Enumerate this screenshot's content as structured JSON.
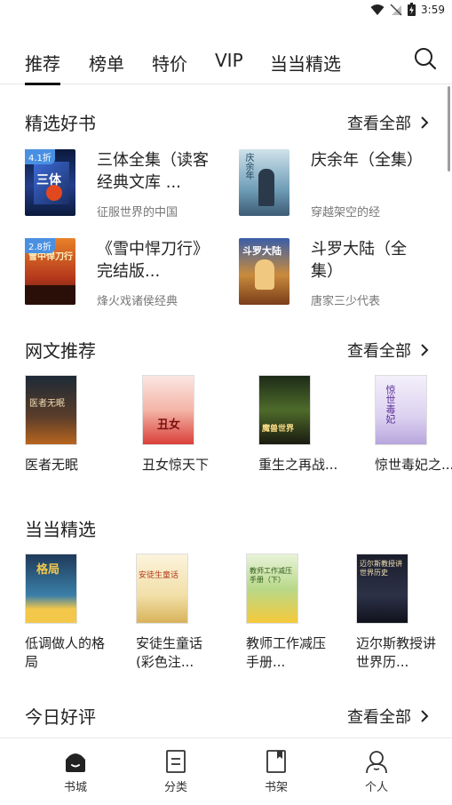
{
  "status": {
    "time": "3:59"
  },
  "tabs": [
    {
      "label": "推荐",
      "active": true
    },
    {
      "label": "榜单"
    },
    {
      "label": "特价"
    },
    {
      "label": "VIP"
    },
    {
      "label": "当当精选"
    }
  ],
  "featured": {
    "title": "精选好书",
    "see_all": "查看全部",
    "books": [
      {
        "title": "三体全集（读客经典文库 ...",
        "desc": "征服世界的中国",
        "discount": "4.1折",
        "cover_text": "三体"
      },
      {
        "title": "庆余年（全集）",
        "desc": "穿越架空的经",
        "cover_text": "庆余年"
      },
      {
        "title": "《雪中悍刀行》完结版...",
        "desc": "烽火戏诸侯经典",
        "discount": "2.8折",
        "cover_text": "雪中悍刀行"
      },
      {
        "title": "斗罗大陆（全集）",
        "desc": "唐家三少代表",
        "cover_text": "斗罗大陆"
      }
    ]
  },
  "web_novels": {
    "title": "网文推荐",
    "see_all": "查看全部",
    "books": [
      {
        "title": "医者无眠",
        "cover_text": "医者无眠"
      },
      {
        "title": "丑女惊天下",
        "cover_text": "丑女"
      },
      {
        "title": "重生之再战...",
        "cover_text": "魔兽世界"
      },
      {
        "title": "惊世毒妃之...",
        "cover_text": "惊世毒妃"
      }
    ]
  },
  "dangdang": {
    "title": "当当精选",
    "books": [
      {
        "title": "低调做人的格局",
        "cover_text": "格局"
      },
      {
        "title": "安徒生童话(彩色注...",
        "cover_text": "安徒生童话"
      },
      {
        "title": "教师工作减压手册...",
        "cover_text": "教师工作减压手册（下）"
      },
      {
        "title": "迈尔斯教授讲世界历...",
        "cover_text": "迈尔斯教授讲世界历史"
      }
    ]
  },
  "today": {
    "title": "今日好评",
    "see_all": "查看全部"
  },
  "nav": [
    {
      "label": "书城"
    },
    {
      "label": "分类"
    },
    {
      "label": "书架"
    },
    {
      "label": "个人"
    }
  ]
}
